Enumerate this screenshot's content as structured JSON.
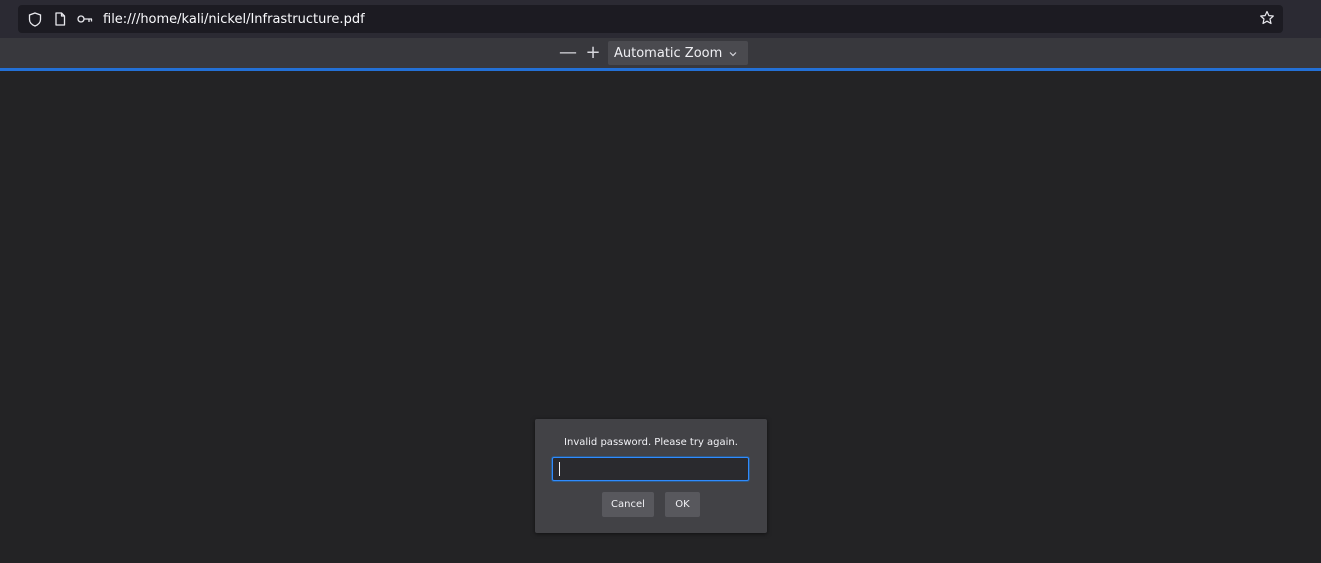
{
  "address_bar": {
    "url": "file:///home/kali/nickel/Infrastructure.pdf",
    "icons": [
      "shield-icon",
      "page-icon",
      "key-icon",
      "star-icon"
    ]
  },
  "pdf_toolbar": {
    "zoom_out_label": "—",
    "zoom_in_label": "+",
    "zoom_selected": "Automatic Zoom"
  },
  "progress": {
    "fraction": 1.0
  },
  "password_dialog": {
    "message": "Invalid password. Please try again.",
    "password_value": "",
    "cancel_label": "Cancel",
    "ok_label": "OK"
  },
  "colors": {
    "accent": "#0a84ff",
    "background": "#232325",
    "toolbar": "#38383d",
    "dialog": "#424246"
  }
}
